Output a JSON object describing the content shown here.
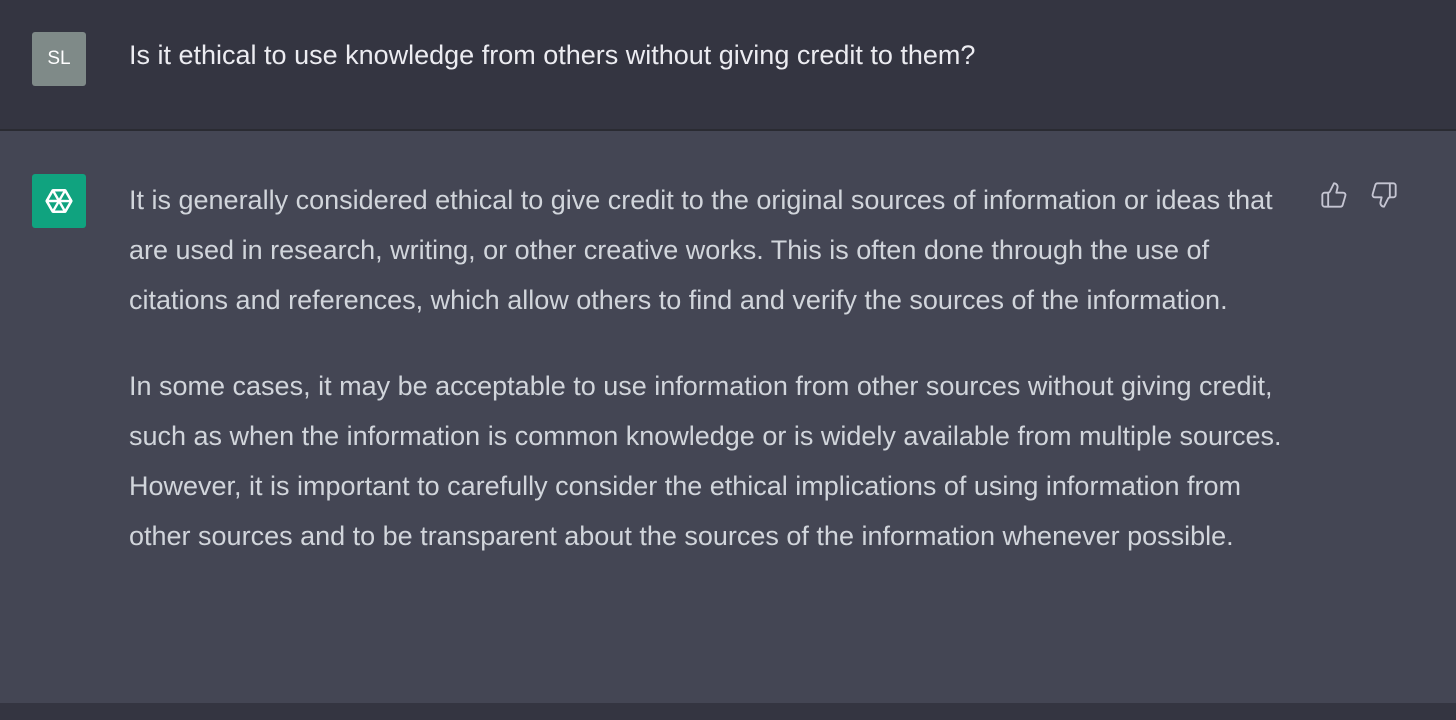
{
  "colors": {
    "user_avatar_bg": "#7f8a88",
    "assistant_avatar_bg": "#10a37f",
    "user_row_bg": "#343541",
    "assistant_row_bg": "#444654"
  },
  "user_message": {
    "avatar_initials": "SL",
    "text": "Is it ethical to use knowledge from others without giving credit to them?"
  },
  "assistant_message": {
    "avatar_icon": "openai-logo-icon",
    "paragraphs": [
      "It is generally considered ethical to give credit to the original sources of information or ideas that are used in research, writing, or other creative works. This is often done through the use of citations and references, which allow others to find and verify the sources of the information.",
      "In some cases, it may be acceptable to use information from other sources without giving credit, such as when the information is common knowledge or is widely available from multiple sources. However, it is important to carefully consider the ethical implications of using information from other sources and to be transparent about the sources of the information whenever possible."
    ],
    "feedback_icons": [
      "thumbs-up-icon",
      "thumbs-down-icon"
    ]
  }
}
